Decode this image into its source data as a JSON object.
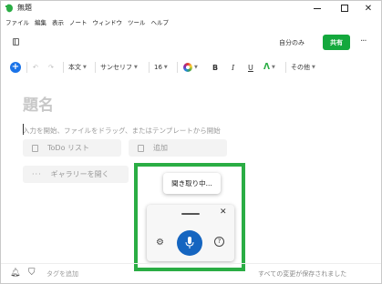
{
  "window": {
    "title": "無題"
  },
  "menu": {
    "items": [
      "ファイル",
      "編集",
      "表示",
      "ノート",
      "ウィンドウ",
      "ツール",
      "ヘルプ"
    ]
  },
  "header": {
    "only_me": "自分のみ",
    "share": "共有"
  },
  "toolbar": {
    "style": "本文",
    "font": "サンセリフ",
    "size": "16",
    "bold": "B",
    "italic": "I",
    "underline": "U",
    "more": "その他"
  },
  "editor": {
    "title_placeholder": "題名",
    "body_placeholder": "入力を開始、ファイルをドラッグ、またはテンプレートから開始",
    "todo_label": "ToDo リスト",
    "add_label": "追加",
    "gallery_label": "ギャラリーを開く"
  },
  "dictation": {
    "tooltip": "聞き取り中..."
  },
  "status": {
    "tag_placeholder": "タグを追加",
    "saved": "すべての変更が保存されました"
  },
  "colors": {
    "accent_green": "#14a83d",
    "highlight": "#2aad44",
    "mic_blue": "#1565c0"
  }
}
